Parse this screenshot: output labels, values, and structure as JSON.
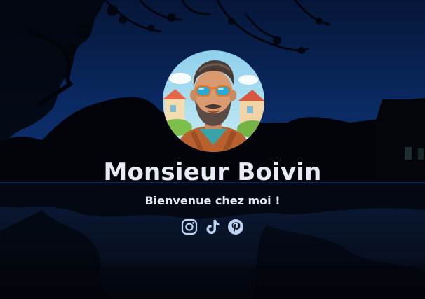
{
  "profile": {
    "name": "Monsieur Boivin",
    "tagline": "Bienvenue chez moi !",
    "avatar_icon": "bearded-man-sunglasses-avatar"
  },
  "socials": [
    {
      "name": "instagram-icon"
    },
    {
      "name": "tiktok-icon"
    },
    {
      "name": "pinterest-icon"
    }
  ],
  "colors": {
    "text": "#e6ebf5",
    "icon": "#bcd3f3",
    "sky": "#0b2350"
  }
}
